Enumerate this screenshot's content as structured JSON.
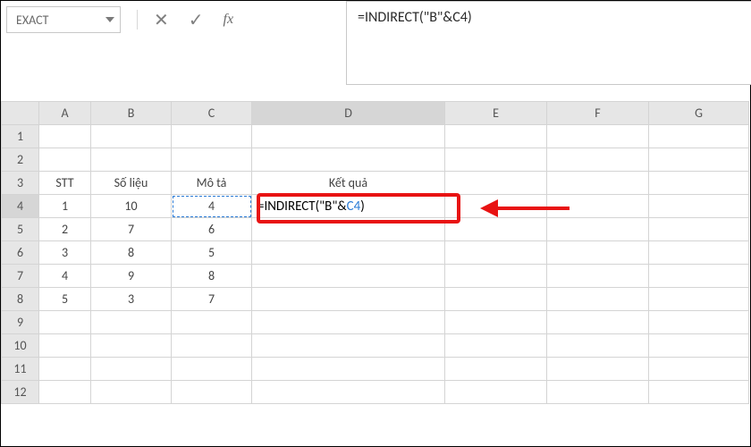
{
  "namebox": {
    "value": "EXACT"
  },
  "formula_controls": {
    "cancel": "✕",
    "enter": "✓",
    "fx": "fx"
  },
  "formula_bar": {
    "text": "=INDIRECT(\"B\"&C4)"
  },
  "columns": [
    "A",
    "B",
    "C",
    "D",
    "E",
    "F",
    "G"
  ],
  "rows": [
    "1",
    "2",
    "3",
    "4",
    "5",
    "6",
    "7",
    "8",
    "9",
    "10",
    "11",
    "12"
  ],
  "headers": {
    "stt": "STT",
    "solieu": "Số liệu",
    "mota": "Mô tả",
    "ketqua": "Kết quả"
  },
  "table": {
    "r4": {
      "stt": "1",
      "sl": "10",
      "mt": "4"
    },
    "r5": {
      "stt": "2",
      "sl": "7",
      "mt": "6"
    },
    "r6": {
      "stt": "3",
      "sl": "8",
      "mt": "5"
    },
    "r7": {
      "stt": "4",
      "sl": "9",
      "mt": "8"
    },
    "r8": {
      "stt": "5",
      "sl": "3",
      "mt": "7"
    }
  },
  "active_cell": {
    "formula_prefix": "=INDIRECT(\"B\"&",
    "formula_ref": "C4",
    "formula_suffix": ")"
  },
  "colors": {
    "excel_green": "#107c41",
    "highlight_red": "#e81313",
    "ref_blue": "#2a7bd6"
  }
}
